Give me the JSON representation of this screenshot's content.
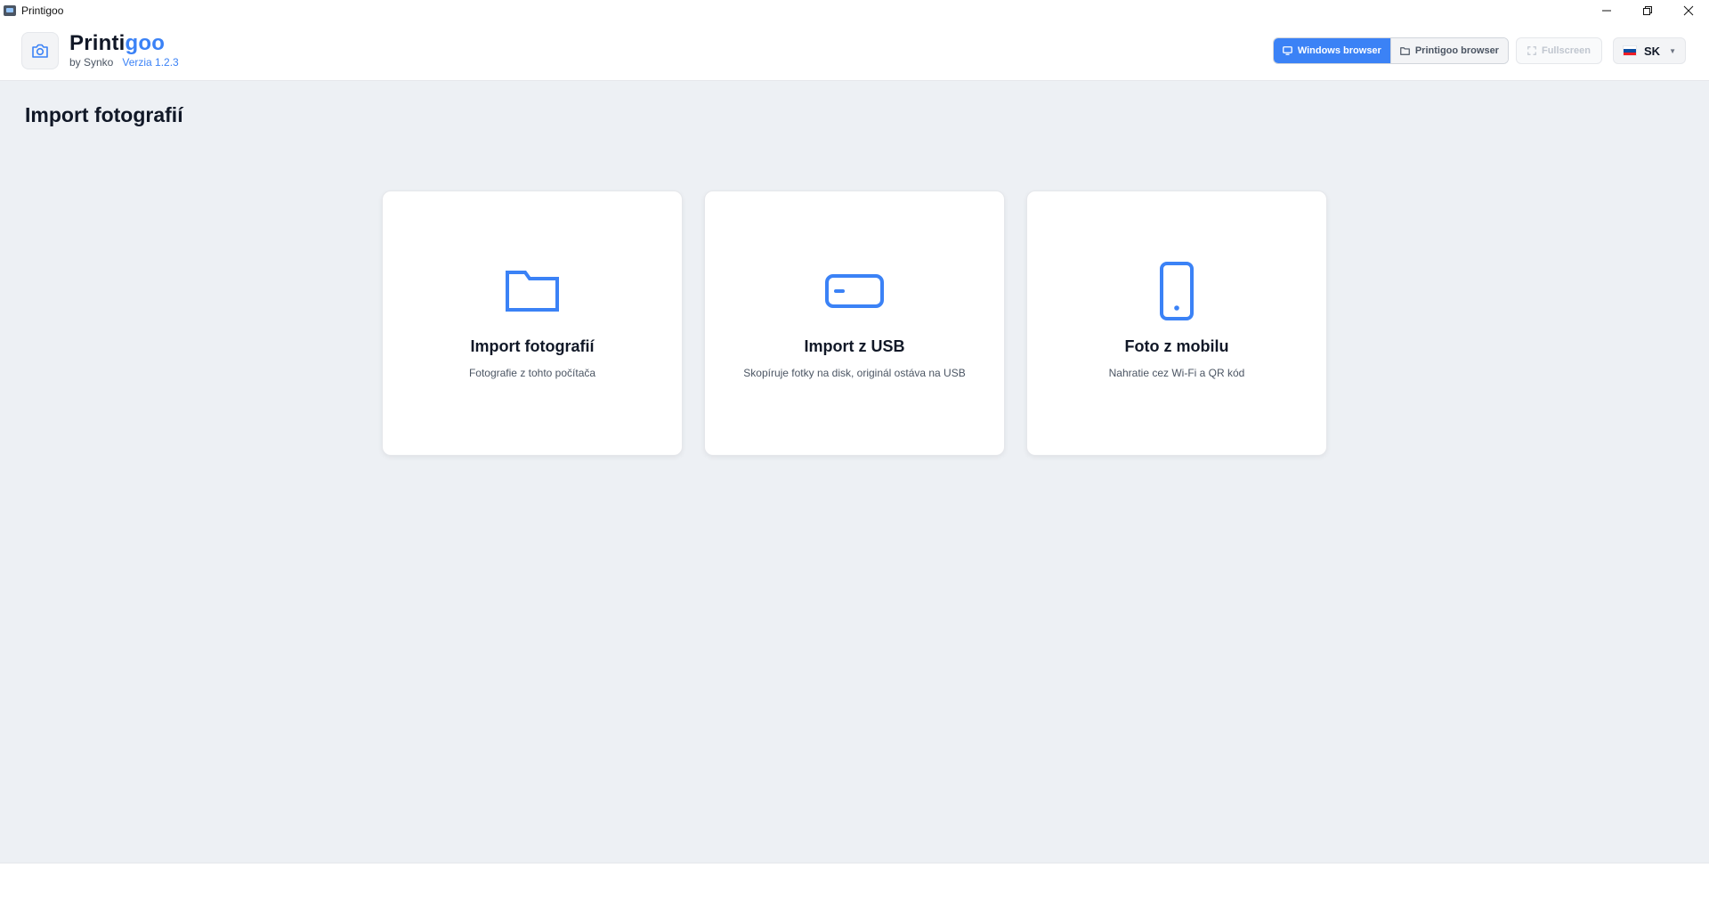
{
  "window": {
    "title": "Printigoo",
    "minimize": "—",
    "restore": "❐",
    "close": "✕"
  },
  "header": {
    "logo_icon": "camera-icon",
    "brand_part1": "Printi",
    "brand_part2": "goo",
    "by_line": "by Synko",
    "version": "Verzia 1.2.3"
  },
  "toolbar": {
    "windows_browser": "Windows browser",
    "printigoo_browser": "Printigoo browser",
    "fullscreen": "Fullscreen",
    "language": "SK",
    "flag_colors": [
      "#ffffff",
      "#0b4ea2",
      "#ee1c25"
    ]
  },
  "page": {
    "title": "Import fotografií"
  },
  "cards": [
    {
      "icon": "folder-icon",
      "title": "Import fotografií",
      "desc": "Fotografie z tohto počítača"
    },
    {
      "icon": "usb-drive-icon",
      "title": "Import z USB",
      "desc": "Skopíruje fotky na disk, originál ostáva na USB"
    },
    {
      "icon": "mobile-phone-icon",
      "title": "Foto z mobilu",
      "desc": "Nahratie cez Wi-Fi a QR kód"
    }
  ],
  "colors": {
    "accent": "#3b82f6",
    "background": "#edf0f4"
  }
}
